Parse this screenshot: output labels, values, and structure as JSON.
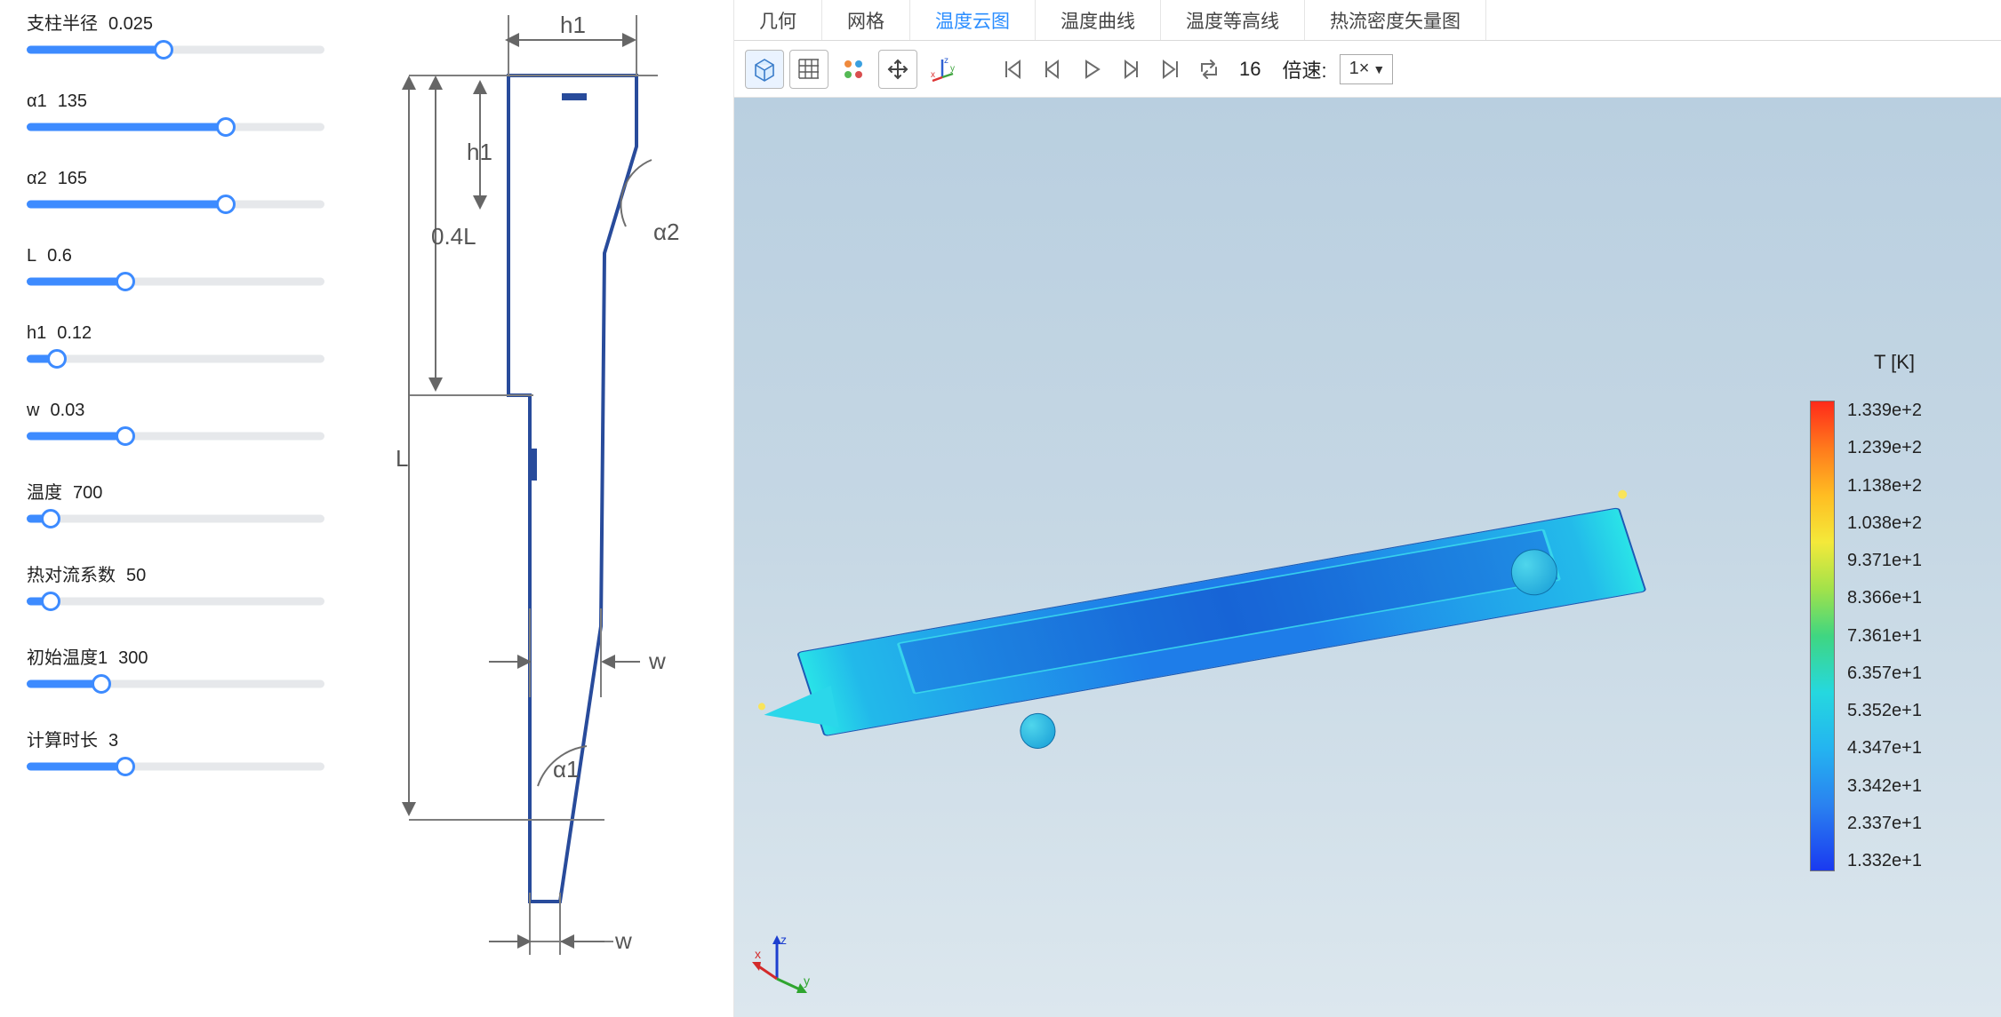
{
  "params": [
    {
      "name": "支柱半径",
      "value": "0.025",
      "percent": 46
    },
    {
      "name": "α1",
      "value": "135",
      "percent": 67
    },
    {
      "name": "α2",
      "value": "165",
      "percent": 67
    },
    {
      "name": "L",
      "value": "0.6",
      "percent": 33
    },
    {
      "name": "h1",
      "value": "0.12",
      "percent": 10
    },
    {
      "name": "w",
      "value": "0.03",
      "percent": 33
    },
    {
      "name": "温度",
      "value": "700",
      "percent": 8
    },
    {
      "name": "热对流系数",
      "value": "50",
      "percent": 8
    },
    {
      "name": "初始温度1",
      "value": "300",
      "percent": 25
    },
    {
      "name": "计算时长",
      "value": "3",
      "percent": 33
    }
  ],
  "schematic": {
    "labels": {
      "h1_top": "h1",
      "h1_mid": "h1",
      "left04L": "0.4L",
      "leftL": "L",
      "a1": "α1",
      "a2": "α2",
      "w1": "w",
      "w2": "w"
    }
  },
  "tabs": [
    {
      "label": "几何",
      "active": false
    },
    {
      "label": "网格",
      "active": false
    },
    {
      "label": "温度云图",
      "active": true
    },
    {
      "label": "温度曲线",
      "active": false
    },
    {
      "label": "温度等高线",
      "active": false
    },
    {
      "label": "热流密度矢量图",
      "active": false
    }
  ],
  "toolbar": {
    "frame_number": "16",
    "speed_label": "倍速:",
    "speed_value": "1×"
  },
  "legend": {
    "title": "T [K]",
    "ticks": [
      "1.339e+2",
      "1.239e+2",
      "1.138e+2",
      "1.038e+2",
      "9.371e+1",
      "8.366e+1",
      "7.361e+1",
      "6.357e+1",
      "5.352e+1",
      "4.347e+1",
      "3.342e+1",
      "2.337e+1",
      "1.332e+1"
    ]
  }
}
